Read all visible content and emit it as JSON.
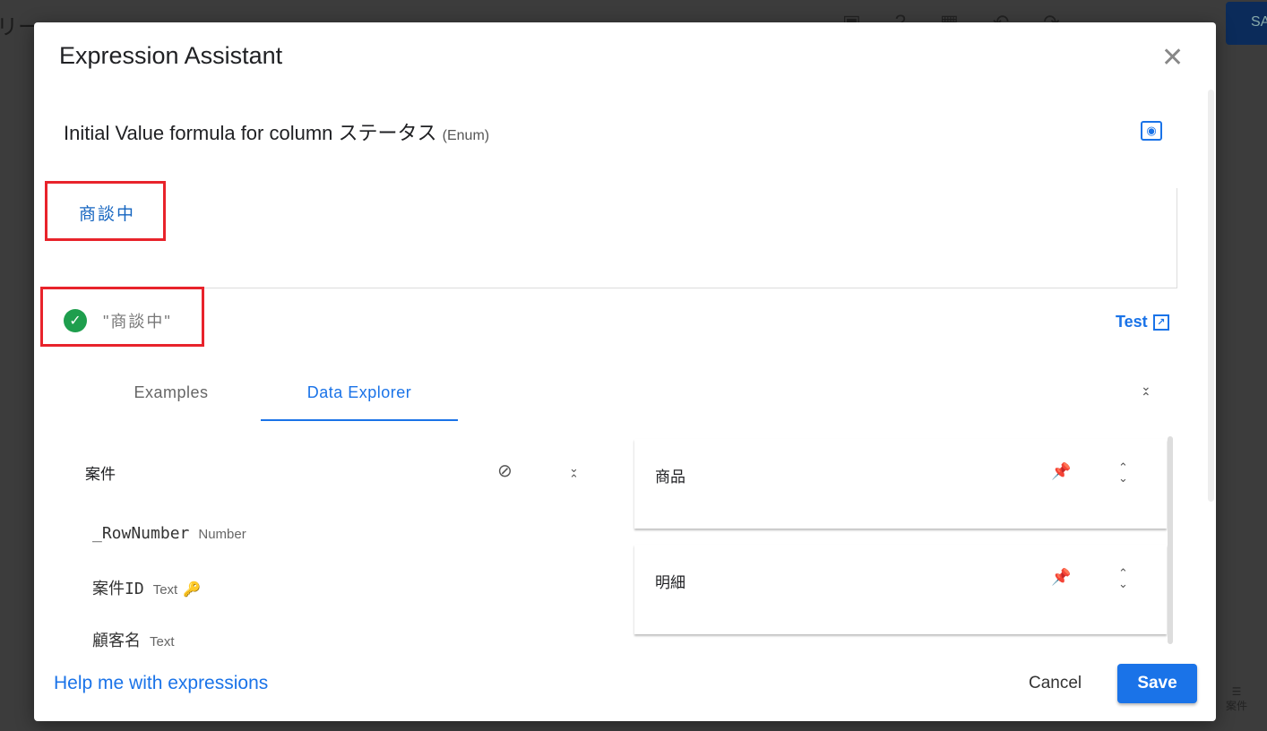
{
  "background": {
    "title": "リー",
    "save_label": "SA",
    "bottom_label": "案件"
  },
  "dialog": {
    "title": "Expression Assistant",
    "subtitle": "Initial Value formula for column ステータス",
    "subtitle_type": "(Enum)",
    "expression": "商談中",
    "result": "\"商談中\"",
    "test_label": "Test",
    "tabs": [
      {
        "label": "Examples"
      },
      {
        "label": "Data Explorer",
        "active": true
      }
    ],
    "table": {
      "name": "案件",
      "columns": [
        {
          "name": "_RowNumber",
          "type": "Number"
        },
        {
          "name": "案件ID",
          "type": "Text",
          "key": true
        },
        {
          "name": "顧客名",
          "type": "Text"
        }
      ]
    },
    "related_tables": [
      {
        "name": "商品"
      },
      {
        "name": "明細"
      }
    ],
    "help_label": "Help me with expressions",
    "cancel_label": "Cancel",
    "save_label": "Save",
    "colors": {
      "accent": "#1a73e8",
      "success": "#1e9e4d",
      "highlight": "#e8232b"
    }
  }
}
